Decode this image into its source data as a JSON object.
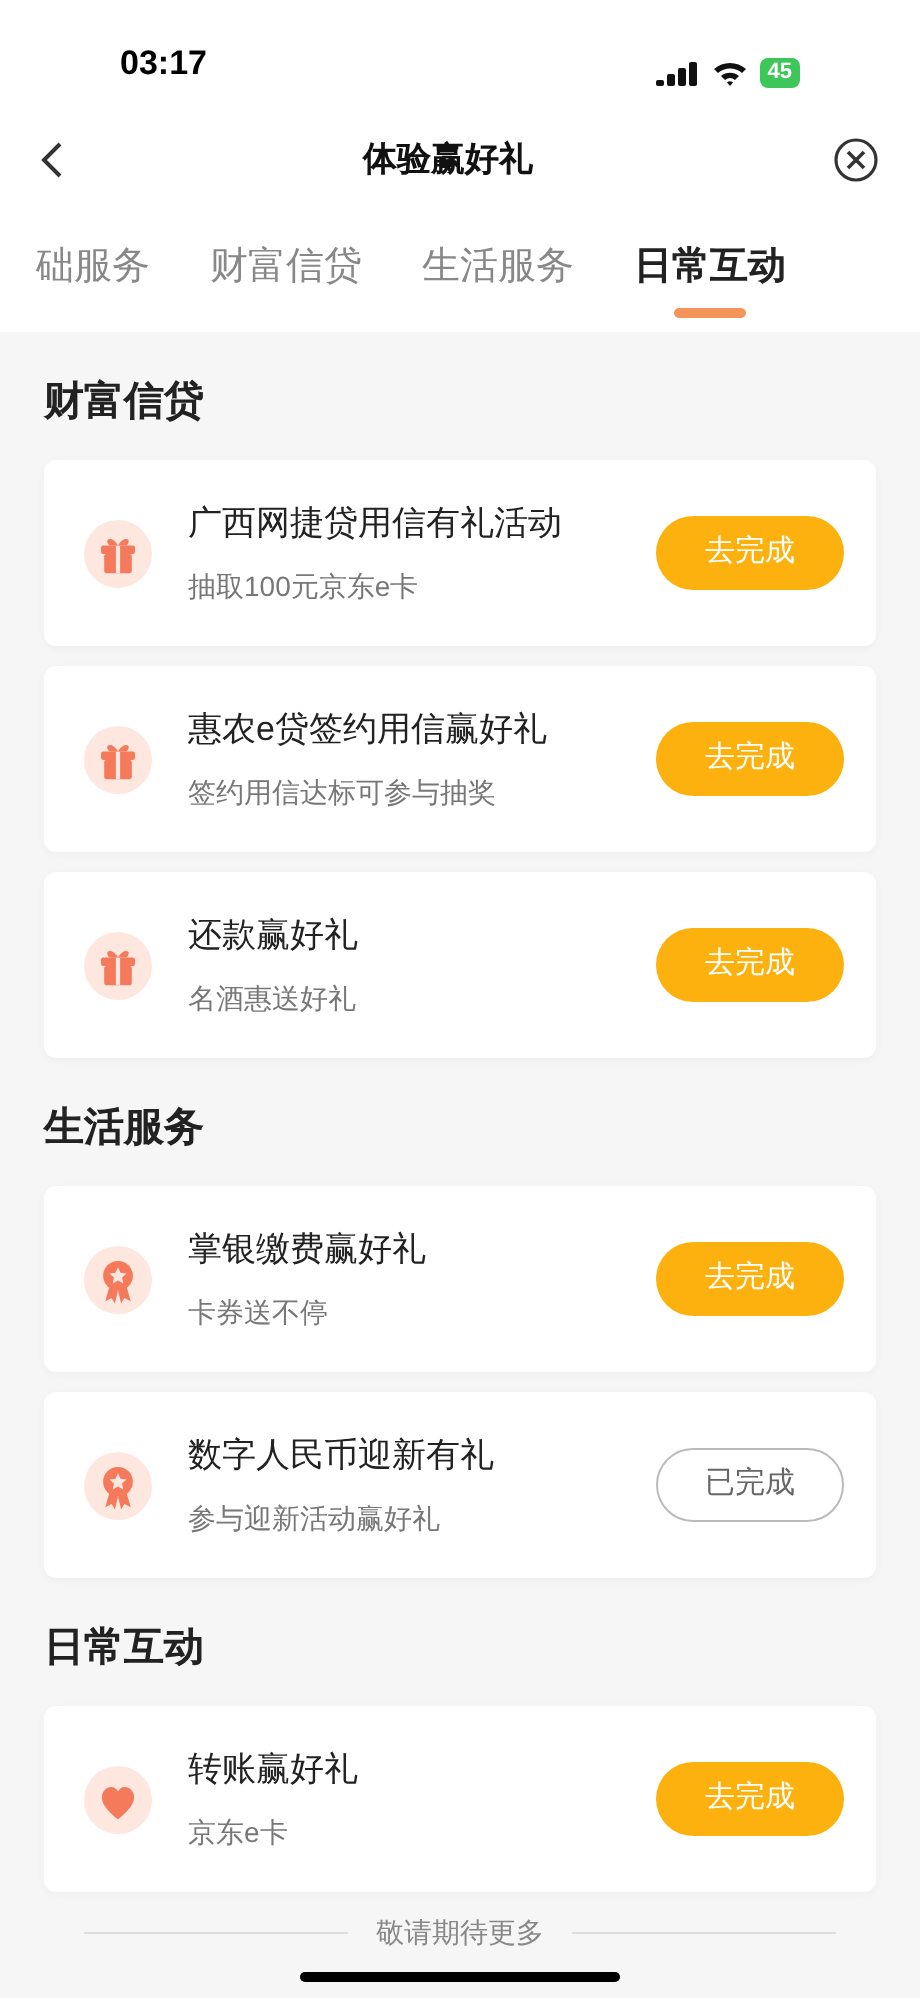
{
  "status_bar": {
    "time": "03:17",
    "battery": "45"
  },
  "header": {
    "title": "体验赢好礼"
  },
  "tabs": [
    {
      "label": "础服务",
      "selected": false
    },
    {
      "label": "财富信贷",
      "selected": false
    },
    {
      "label": "生活服务",
      "selected": false
    },
    {
      "label": "日常互动",
      "selected": true
    }
  ],
  "sections": [
    {
      "title": "财富信贷",
      "items": [
        {
          "kind": "gift",
          "title": "广西网捷贷用信有礼活动",
          "subtitle": "抽取100元京东e卡",
          "button": "去完成",
          "done": false
        },
        {
          "kind": "gift",
          "title": "惠农e贷签约用信赢好礼",
          "subtitle": "签约用信达标可参与抽奖",
          "button": "去完成",
          "done": false
        },
        {
          "kind": "gift",
          "title": "还款赢好礼",
          "subtitle": "名酒惠送好礼",
          "button": "去完成",
          "done": false
        }
      ]
    },
    {
      "title": "生活服务",
      "items": [
        {
          "kind": "medal",
          "title": "掌银缴费赢好礼",
          "subtitle": "卡券送不停",
          "button": "去完成",
          "done": false
        },
        {
          "kind": "medal",
          "title": "数字人民币迎新有礼",
          "subtitle": "参与迎新活动赢好礼",
          "button": "已完成",
          "done": true
        }
      ]
    },
    {
      "title": "日常互动",
      "items": [
        {
          "kind": "heart",
          "title": "转账赢好礼",
          "subtitle": "京东e卡",
          "button": "去完成",
          "done": false
        }
      ]
    }
  ],
  "footer": "敬请期待更多"
}
